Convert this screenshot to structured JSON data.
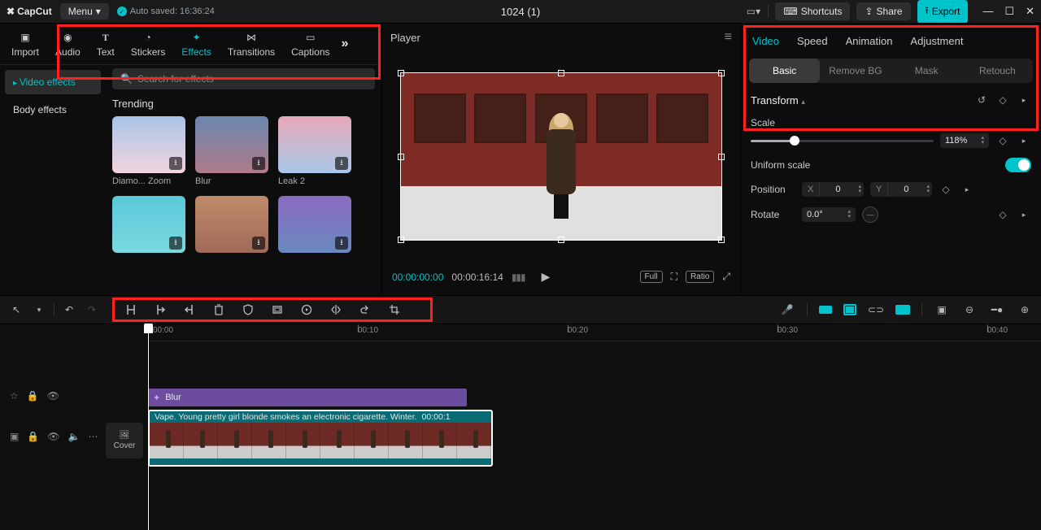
{
  "titlebar": {
    "logo": "CapCut",
    "menu": "Menu",
    "autosave": "Auto saved: 16:36:24",
    "project": "1024 (1)",
    "shortcuts": "Shortcuts",
    "share": "Share",
    "export": "Export"
  },
  "top_tabs": {
    "import": "Import",
    "audio": "Audio",
    "text": "Text",
    "stickers": "Stickers",
    "effects": "Effects",
    "transitions": "Transitions",
    "captions": "Captions"
  },
  "effects_panel": {
    "video_effects": "Video effects",
    "body_effects": "Body effects",
    "search_placeholder": "Search for effects",
    "section": "Trending",
    "thumbs": [
      {
        "label": "Diamo... Zoom"
      },
      {
        "label": "Blur"
      },
      {
        "label": "Leak 2"
      },
      {
        "label": ""
      },
      {
        "label": ""
      },
      {
        "label": ""
      }
    ]
  },
  "player": {
    "title": "Player",
    "time_current": "00:00:00:00",
    "time_total": "00:00:16:14",
    "full": "Full",
    "ratio": "Ratio"
  },
  "inspector": {
    "tabs": {
      "video": "Video",
      "speed": "Speed",
      "animation": "Animation",
      "adjustment": "Adjustment"
    },
    "subtabs": {
      "basic": "Basic",
      "removebg": "Remove BG",
      "mask": "Mask",
      "retouch": "Retouch"
    },
    "transform": "Transform",
    "scale_label": "Scale",
    "scale_value": "118%",
    "uniform": "Uniform scale",
    "position": "Position",
    "pos_x": "0",
    "pos_y": "0",
    "rotate": "Rotate",
    "rotate_value": "0.0°"
  },
  "ruler": {
    "t0": "00:00",
    "t10": "00:10",
    "t20": "00:20",
    "t30": "00:30",
    "t40": "00:40"
  },
  "timeline": {
    "cover": "Cover",
    "effect_clip": "Blur",
    "clip_title": "Vape. Young pretty girl blonde smokes an electronic cigarette. Winter.",
    "clip_time": "00:00:1"
  }
}
